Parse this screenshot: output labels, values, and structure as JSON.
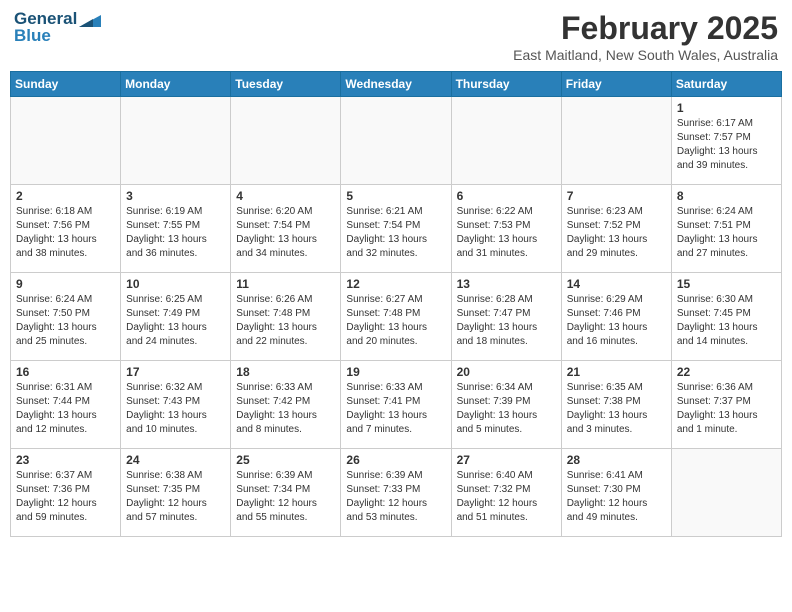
{
  "header": {
    "logo_general": "General",
    "logo_blue": "Blue",
    "month_title": "February 2025",
    "location": "East Maitland, New South Wales, Australia"
  },
  "weekdays": [
    "Sunday",
    "Monday",
    "Tuesday",
    "Wednesday",
    "Thursday",
    "Friday",
    "Saturday"
  ],
  "weeks": [
    [
      {
        "day": "",
        "info": ""
      },
      {
        "day": "",
        "info": ""
      },
      {
        "day": "",
        "info": ""
      },
      {
        "day": "",
        "info": ""
      },
      {
        "day": "",
        "info": ""
      },
      {
        "day": "",
        "info": ""
      },
      {
        "day": "1",
        "info": "Sunrise: 6:17 AM\nSunset: 7:57 PM\nDaylight: 13 hours\nand 39 minutes."
      }
    ],
    [
      {
        "day": "2",
        "info": "Sunrise: 6:18 AM\nSunset: 7:56 PM\nDaylight: 13 hours\nand 38 minutes."
      },
      {
        "day": "3",
        "info": "Sunrise: 6:19 AM\nSunset: 7:55 PM\nDaylight: 13 hours\nand 36 minutes."
      },
      {
        "day": "4",
        "info": "Sunrise: 6:20 AM\nSunset: 7:54 PM\nDaylight: 13 hours\nand 34 minutes."
      },
      {
        "day": "5",
        "info": "Sunrise: 6:21 AM\nSunset: 7:54 PM\nDaylight: 13 hours\nand 32 minutes."
      },
      {
        "day": "6",
        "info": "Sunrise: 6:22 AM\nSunset: 7:53 PM\nDaylight: 13 hours\nand 31 minutes."
      },
      {
        "day": "7",
        "info": "Sunrise: 6:23 AM\nSunset: 7:52 PM\nDaylight: 13 hours\nand 29 minutes."
      },
      {
        "day": "8",
        "info": "Sunrise: 6:24 AM\nSunset: 7:51 PM\nDaylight: 13 hours\nand 27 minutes."
      }
    ],
    [
      {
        "day": "9",
        "info": "Sunrise: 6:24 AM\nSunset: 7:50 PM\nDaylight: 13 hours\nand 25 minutes."
      },
      {
        "day": "10",
        "info": "Sunrise: 6:25 AM\nSunset: 7:49 PM\nDaylight: 13 hours\nand 24 minutes."
      },
      {
        "day": "11",
        "info": "Sunrise: 6:26 AM\nSunset: 7:48 PM\nDaylight: 13 hours\nand 22 minutes."
      },
      {
        "day": "12",
        "info": "Sunrise: 6:27 AM\nSunset: 7:48 PM\nDaylight: 13 hours\nand 20 minutes."
      },
      {
        "day": "13",
        "info": "Sunrise: 6:28 AM\nSunset: 7:47 PM\nDaylight: 13 hours\nand 18 minutes."
      },
      {
        "day": "14",
        "info": "Sunrise: 6:29 AM\nSunset: 7:46 PM\nDaylight: 13 hours\nand 16 minutes."
      },
      {
        "day": "15",
        "info": "Sunrise: 6:30 AM\nSunset: 7:45 PM\nDaylight: 13 hours\nand 14 minutes."
      }
    ],
    [
      {
        "day": "16",
        "info": "Sunrise: 6:31 AM\nSunset: 7:44 PM\nDaylight: 13 hours\nand 12 minutes."
      },
      {
        "day": "17",
        "info": "Sunrise: 6:32 AM\nSunset: 7:43 PM\nDaylight: 13 hours\nand 10 minutes."
      },
      {
        "day": "18",
        "info": "Sunrise: 6:33 AM\nSunset: 7:42 PM\nDaylight: 13 hours\nand 8 minutes."
      },
      {
        "day": "19",
        "info": "Sunrise: 6:33 AM\nSunset: 7:41 PM\nDaylight: 13 hours\nand 7 minutes."
      },
      {
        "day": "20",
        "info": "Sunrise: 6:34 AM\nSunset: 7:39 PM\nDaylight: 13 hours\nand 5 minutes."
      },
      {
        "day": "21",
        "info": "Sunrise: 6:35 AM\nSunset: 7:38 PM\nDaylight: 13 hours\nand 3 minutes."
      },
      {
        "day": "22",
        "info": "Sunrise: 6:36 AM\nSunset: 7:37 PM\nDaylight: 13 hours\nand 1 minute."
      }
    ],
    [
      {
        "day": "23",
        "info": "Sunrise: 6:37 AM\nSunset: 7:36 PM\nDaylight: 12 hours\nand 59 minutes."
      },
      {
        "day": "24",
        "info": "Sunrise: 6:38 AM\nSunset: 7:35 PM\nDaylight: 12 hours\nand 57 minutes."
      },
      {
        "day": "25",
        "info": "Sunrise: 6:39 AM\nSunset: 7:34 PM\nDaylight: 12 hours\nand 55 minutes."
      },
      {
        "day": "26",
        "info": "Sunrise: 6:39 AM\nSunset: 7:33 PM\nDaylight: 12 hours\nand 53 minutes."
      },
      {
        "day": "27",
        "info": "Sunrise: 6:40 AM\nSunset: 7:32 PM\nDaylight: 12 hours\nand 51 minutes."
      },
      {
        "day": "28",
        "info": "Sunrise: 6:41 AM\nSunset: 7:30 PM\nDaylight: 12 hours\nand 49 minutes."
      },
      {
        "day": "",
        "info": ""
      }
    ]
  ]
}
